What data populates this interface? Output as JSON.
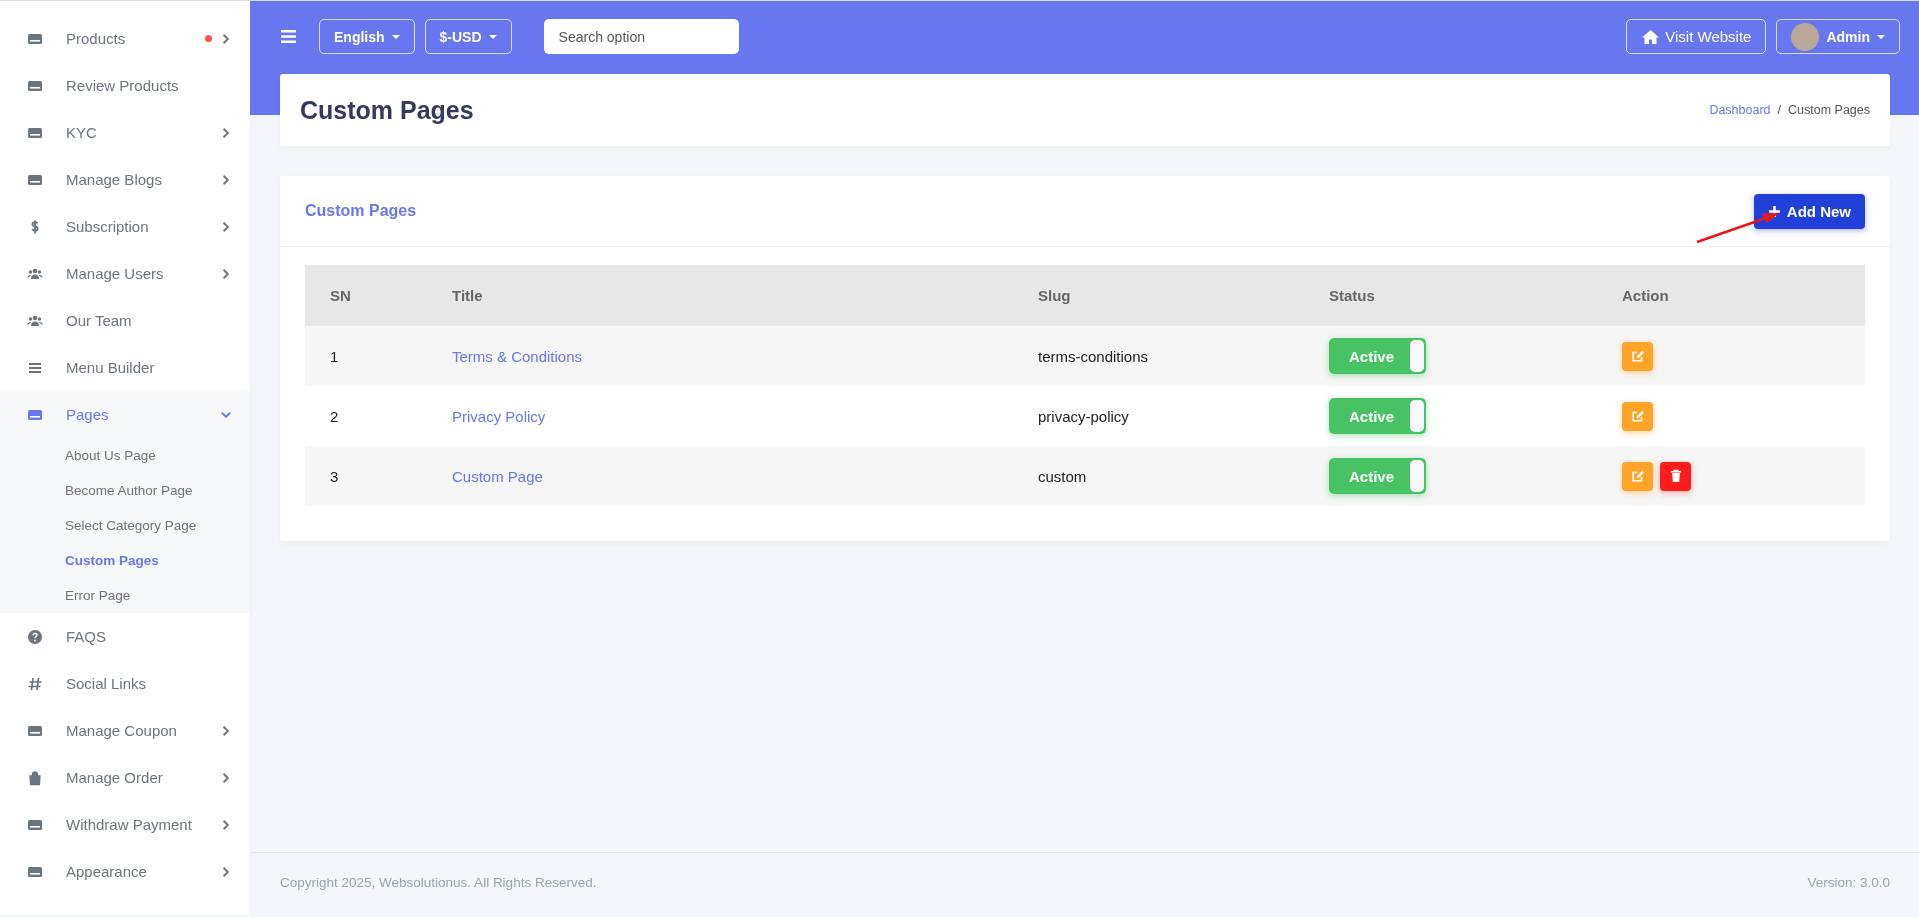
{
  "sidebar": {
    "items": [
      {
        "label": "Products",
        "has_submenu": true,
        "notification": true,
        "expanded": false,
        "selected": false
      },
      {
        "label": "Review Products",
        "has_submenu": false,
        "notification": false,
        "selected": false
      },
      {
        "label": "KYC",
        "has_submenu": true,
        "notification": false,
        "expanded": false,
        "selected": false
      },
      {
        "label": "Manage Blogs",
        "has_submenu": true,
        "notification": false,
        "expanded": false,
        "selected": false
      },
      {
        "label": "Subscription",
        "has_submenu": true,
        "notification": false,
        "expanded": false,
        "selected": false
      },
      {
        "label": "Manage Users",
        "has_submenu": true,
        "notification": false,
        "expanded": false,
        "selected": false
      },
      {
        "label": "Our Team",
        "has_submenu": false,
        "notification": false,
        "selected": false
      },
      {
        "label": "Menu Builder",
        "has_submenu": false,
        "notification": false,
        "selected": false
      },
      {
        "label": "Pages",
        "has_submenu": true,
        "notification": false,
        "expanded": true,
        "selected": true,
        "children": [
          {
            "label": "About Us Page",
            "selected": false
          },
          {
            "label": "Become Author Page",
            "selected": false
          },
          {
            "label": "Select Category Page",
            "selected": false
          },
          {
            "label": "Custom Pages",
            "selected": true
          },
          {
            "label": "Error Page",
            "selected": false
          }
        ]
      },
      {
        "label": "FAQS",
        "has_submenu": false,
        "notification": false,
        "selected": false
      },
      {
        "label": "Social Links",
        "has_submenu": false,
        "notification": false,
        "selected": false
      },
      {
        "label": "Manage Coupon",
        "has_submenu": true,
        "notification": false,
        "expanded": false,
        "selected": false
      },
      {
        "label": "Manage Order",
        "has_submenu": true,
        "notification": false,
        "expanded": false,
        "selected": false
      },
      {
        "label": "Withdraw Payment",
        "has_submenu": true,
        "notification": false,
        "expanded": false,
        "selected": false
      },
      {
        "label": "Appearance",
        "has_submenu": true,
        "notification": false,
        "expanded": false,
        "selected": false
      }
    ]
  },
  "topbar": {
    "language": "English",
    "currency": "$-USD",
    "search": {
      "placeholder": "Search option"
    },
    "visit_website": "Visit Website",
    "user": "Admin"
  },
  "page_header": {
    "title": "Custom Pages",
    "breadcrumb": [
      {
        "label": "Dashboard",
        "kind": "link"
      },
      {
        "label": "Custom Pages",
        "kind": "current"
      }
    ],
    "separator": "/"
  },
  "card": {
    "title": "Custom Pages",
    "add_button": "Add New",
    "table": {
      "columns": [
        "SN",
        "Title",
        "Slug",
        "Status",
        "Action"
      ],
      "rows": [
        {
          "sn": "1",
          "title": "Terms & Conditions",
          "slug": "terms-conditions",
          "status": {
            "label": "Active",
            "on": true
          },
          "actions": [
            {
              "kind": "edit"
            }
          ]
        },
        {
          "sn": "2",
          "title": "Privacy Policy",
          "slug": "privacy-policy",
          "status": {
            "label": "Active",
            "on": true
          },
          "actions": [
            {
              "kind": "edit"
            }
          ]
        },
        {
          "sn": "3",
          "title": "Custom Page",
          "slug": "custom",
          "status": {
            "label": "Active",
            "on": true
          },
          "actions": [
            {
              "kind": "edit"
            },
            {
              "kind": "delete"
            }
          ]
        }
      ]
    }
  },
  "footer": {
    "copyright": "Copyright 2025, Websolutionus. All Rights Reserved.",
    "version": "Version: 3.0.0"
  }
}
